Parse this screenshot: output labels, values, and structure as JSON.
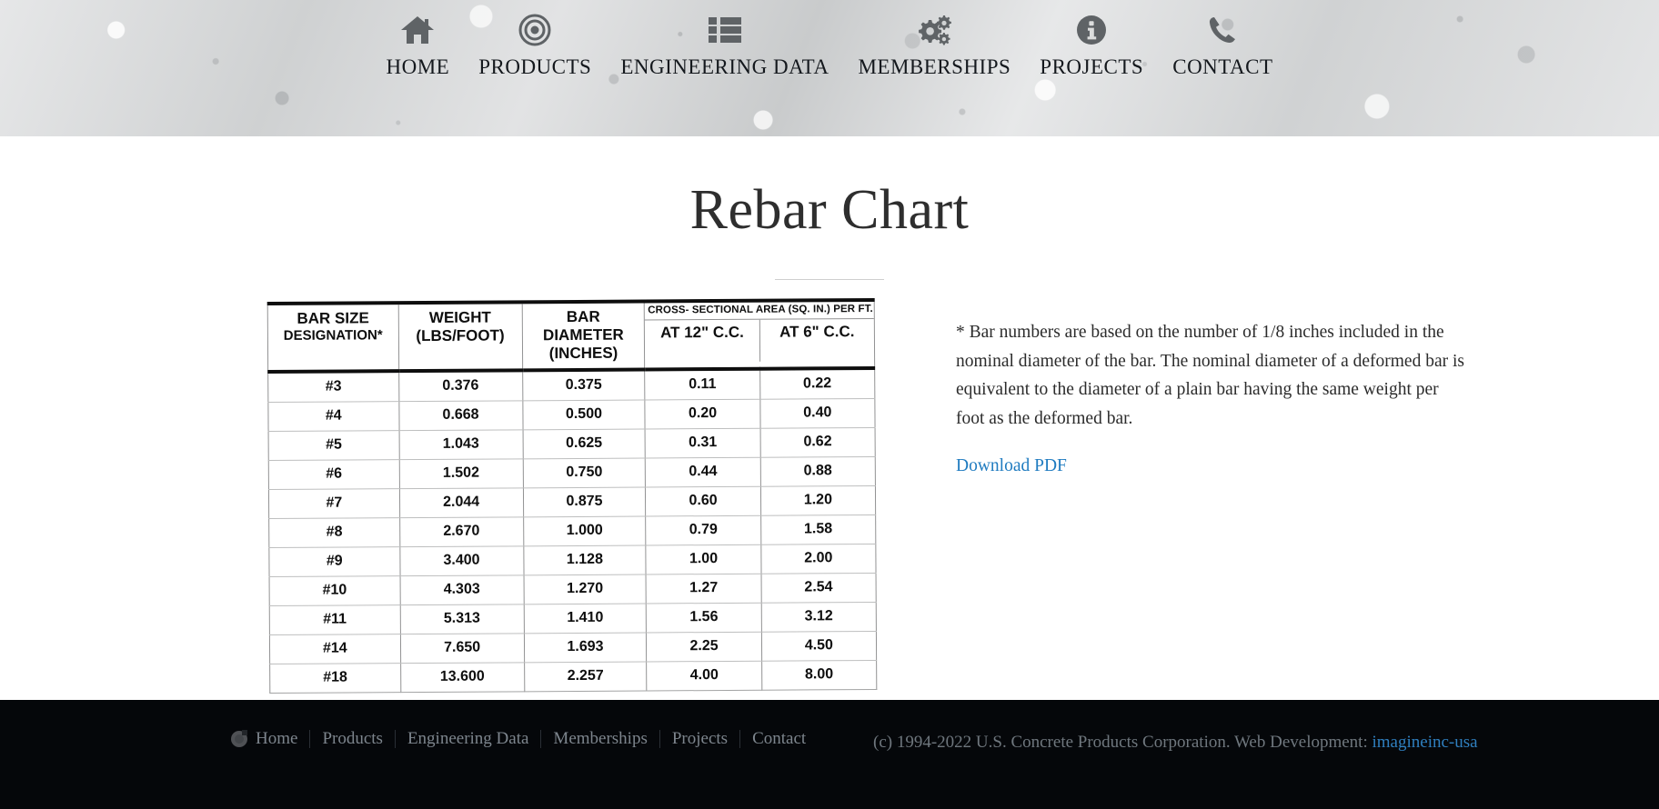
{
  "header": {
    "nav_items": [
      {
        "label": "HOME",
        "icon": "home-icon"
      },
      {
        "label": "PRODUCTS",
        "icon": "target-icon"
      },
      {
        "label": "ENGINEERING DATA",
        "icon": "list-icon"
      },
      {
        "label": "MEMBERSHIPS",
        "icon": "gears-icon"
      },
      {
        "label": "PROJECTS",
        "icon": "info-icon"
      },
      {
        "label": "CONTACT",
        "icon": "phone-icon"
      }
    ]
  },
  "main": {
    "page_title": "Rebar Chart",
    "note_text": "* Bar numbers are based on the number of 1/8 inches included in the nominal diameter of the bar.  The nominal diameter of a deformed bar is equivalent to the diameter of a plain bar having the same weight per foot as the deformed bar.",
    "download_label": "Download PDF"
  },
  "chart_data": {
    "type": "table",
    "title": "Rebar Chart",
    "group_header": "CROSS- SECTIONAL AREA (SQ. IN.) PER FT.",
    "columns": [
      {
        "line1": "BAR SIZE",
        "line2": "DESIGNATION*",
        "line3": ""
      },
      {
        "line1": "WEIGHT",
        "line2": "(LBS/FOOT)",
        "line3": ""
      },
      {
        "line1": "BAR",
        "line2": "DIAMETER",
        "line3": "(INCHES)"
      }
    ],
    "group_columns": [
      "AT 12\" C.C.",
      "AT 6\" C.C."
    ],
    "rows": [
      {
        "size": "#3",
        "weight": "0.376",
        "diameter": "0.375",
        "area12": "0.11",
        "area6": "0.22"
      },
      {
        "size": "#4",
        "weight": "0.668",
        "diameter": "0.500",
        "area12": "0.20",
        "area6": "0.40"
      },
      {
        "size": "#5",
        "weight": "1.043",
        "diameter": "0.625",
        "area12": "0.31",
        "area6": "0.62"
      },
      {
        "size": "#6",
        "weight": "1.502",
        "diameter": "0.750",
        "area12": "0.44",
        "area6": "0.88"
      },
      {
        "size": "#7",
        "weight": "2.044",
        "diameter": "0.875",
        "area12": "0.60",
        "area6": "1.20"
      },
      {
        "size": "#8",
        "weight": "2.670",
        "diameter": "1.000",
        "area12": "0.79",
        "area6": "1.58"
      },
      {
        "size": "#9",
        "weight": "3.400",
        "diameter": "1.128",
        "area12": "1.00",
        "area6": "2.00"
      },
      {
        "size": "#10",
        "weight": "4.303",
        "diameter": "1.270",
        "area12": "1.27",
        "area6": "2.54"
      },
      {
        "size": "#11",
        "weight": "5.313",
        "diameter": "1.410",
        "area12": "1.56",
        "area6": "3.12"
      },
      {
        "size": "#14",
        "weight": "7.650",
        "diameter": "1.693",
        "area12": "2.25",
        "area6": "4.50"
      },
      {
        "size": "#18",
        "weight": "13.600",
        "diameter": "2.257",
        "area12": "4.00",
        "area6": "8.00"
      }
    ]
  },
  "footer": {
    "nav_items": [
      {
        "label": "Home"
      },
      {
        "label": "Products"
      },
      {
        "label": "Engineering Data"
      },
      {
        "label": "Memberships"
      },
      {
        "label": "Projects"
      },
      {
        "label": "Contact"
      }
    ],
    "copyright": "(c) 1994-2022 U.S. Concrete Products Corporation. Web Development:",
    "developer_link": "imagineinc-usa"
  },
  "colors": {
    "link": "#1f7bc0",
    "footer_bg": "#05070a",
    "header_bg": "#d0d2d3"
  }
}
